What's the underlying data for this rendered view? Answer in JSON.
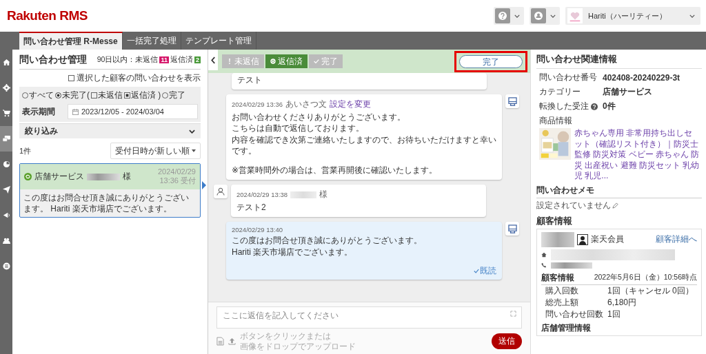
{
  "header": {
    "logo": "Rakuten RMS",
    "shop": "Hariti（ハーリティー）"
  },
  "nav_tabs": [
    {
      "label": "問い合わせ管理 R-Messe",
      "selected": true
    },
    {
      "label": "一括完了処理",
      "selected": false
    },
    {
      "label": "テンプレート管理",
      "selected": false
    }
  ],
  "rail": [
    {
      "kind": "home",
      "selected": false
    },
    {
      "kind": "gear",
      "selected": false
    },
    {
      "kind": "cart",
      "selected": false
    },
    {
      "kind": "chat",
      "selected": true
    },
    {
      "kind": "chart",
      "selected": false
    },
    {
      "kind": "send",
      "selected": false
    },
    {
      "kind": "megaphone",
      "selected": false
    },
    {
      "kind": "people",
      "selected": false
    },
    {
      "kind": "list",
      "selected": false
    }
  ],
  "list_panel": {
    "title": "問い合わせ管理",
    "range_label": "90日以内：未返信",
    "unreplied_count": "11",
    "replied_label": "返信済",
    "replied_count": "2",
    "show_selected": {
      "label": "選択した顧客の問い合わせを表示",
      "checked": false
    },
    "status_filter": [
      {
        "kind": "radio",
        "label": "すべて",
        "selected": false
      },
      {
        "kind": "radio",
        "label": "未完了(",
        "selected": true
      },
      {
        "kind": "checkbox",
        "label": "未返信",
        "checked": false
      },
      {
        "kind": "checkbox",
        "label": "返信済 )",
        "checked": true
      },
      {
        "kind": "radio",
        "label": "完了",
        "selected": false
      }
    ],
    "period_label": "表示期間",
    "period_value": "2023/12/05 - 2024/03/04",
    "refine": {
      "label": "絞り込み",
      "expanded": false
    },
    "count": "1件",
    "sort": "受付日時が新しい順",
    "inquiries": [
      {
        "category": "店舗サービス",
        "honorific": "様",
        "date": "2024/02/29",
        "time": "13:36 受付",
        "body": "この度はお問合せ頂き誠にありがとうございます。 Hariti 楽天市場店でございます。",
        "selected": true
      }
    ]
  },
  "thread": {
    "status_buttons": [
      {
        "kind": "unreplied",
        "label": "未返信",
        "selected": false
      },
      {
        "kind": "replied",
        "label": "返信済",
        "selected": true
      },
      {
        "kind": "done",
        "label": "完了",
        "selected": false
      }
    ],
    "complete_button": "完了",
    "messages": [
      {
        "kind": "customer",
        "paragraphs": [
          [
            "テスト"
          ]
        ]
      },
      {
        "kind": "shop",
        "time": "2024/02/29 13:36",
        "tag": "あいさつ文",
        "link": "設定を変更",
        "paragraphs": [
          [
            "お問い合わせくださりありがとうございます。",
            "こちらは自動で返信しております。",
            "内容を確認でき次第ご連絡いたしますので、お待ちいただけますと幸いです。"
          ],
          [
            "※営業時間外の場合は、営業再開後に確認いたします。"
          ]
        ],
        "highlight": false
      },
      {
        "kind": "customer",
        "time": "2024/02/29 13:38",
        "honorific": "様",
        "paragraphs": [
          [
            "テスト2"
          ]
        ],
        "avatar": true
      },
      {
        "kind": "shop",
        "time": "2024/02/29 13:40",
        "paragraphs": [
          [
            "この度はお問合せ頂き誠にありがとうございます。",
            "Hariti 楽天市場店でございます。"
          ]
        ],
        "highlight": true,
        "read": "既読"
      }
    ],
    "reply": {
      "placeholder": "ここに返信を記入してください",
      "upload_hint": [
        "ボタンをクリックまたは",
        "画像をドロップでアップロード"
      ],
      "send": "送信"
    }
  },
  "info_panel": {
    "title": "問い合わせ関連情報",
    "rows": [
      {
        "label": "問い合わせ番号",
        "value": "402408-20240229-3t",
        "help": false
      },
      {
        "label": "カテゴリー",
        "value": "店舗サービス",
        "help": false
      },
      {
        "label": "転換した受注",
        "value": "0件",
        "help": true
      }
    ],
    "product_label": "商品情報",
    "product_title": "赤ちゃん専用 非常用持ち出しセット（確認リスト付き）｜防災士監修 防災対策 ベビー 赤ちゃん 防災 出産祝い 避難 防災セット 乳幼児 乳児...",
    "memo_title": "問い合わせメモ",
    "memo": "設定されていません",
    "customer_title": "顧客情報",
    "member": "楽天会員",
    "detail_link": "顧客詳細へ",
    "stats_title": "顧客情報",
    "stats_asof": "2022年5月6日（金）10:56時点",
    "stats": [
      {
        "label": "購入回数",
        "value": "1回（キャンセル 0回）"
      },
      {
        "label": "総売上額",
        "value": "6,180円"
      },
      {
        "label": "問い合わせ回数",
        "value": "1回"
      }
    ],
    "store_title": "店舗管理情報"
  }
}
